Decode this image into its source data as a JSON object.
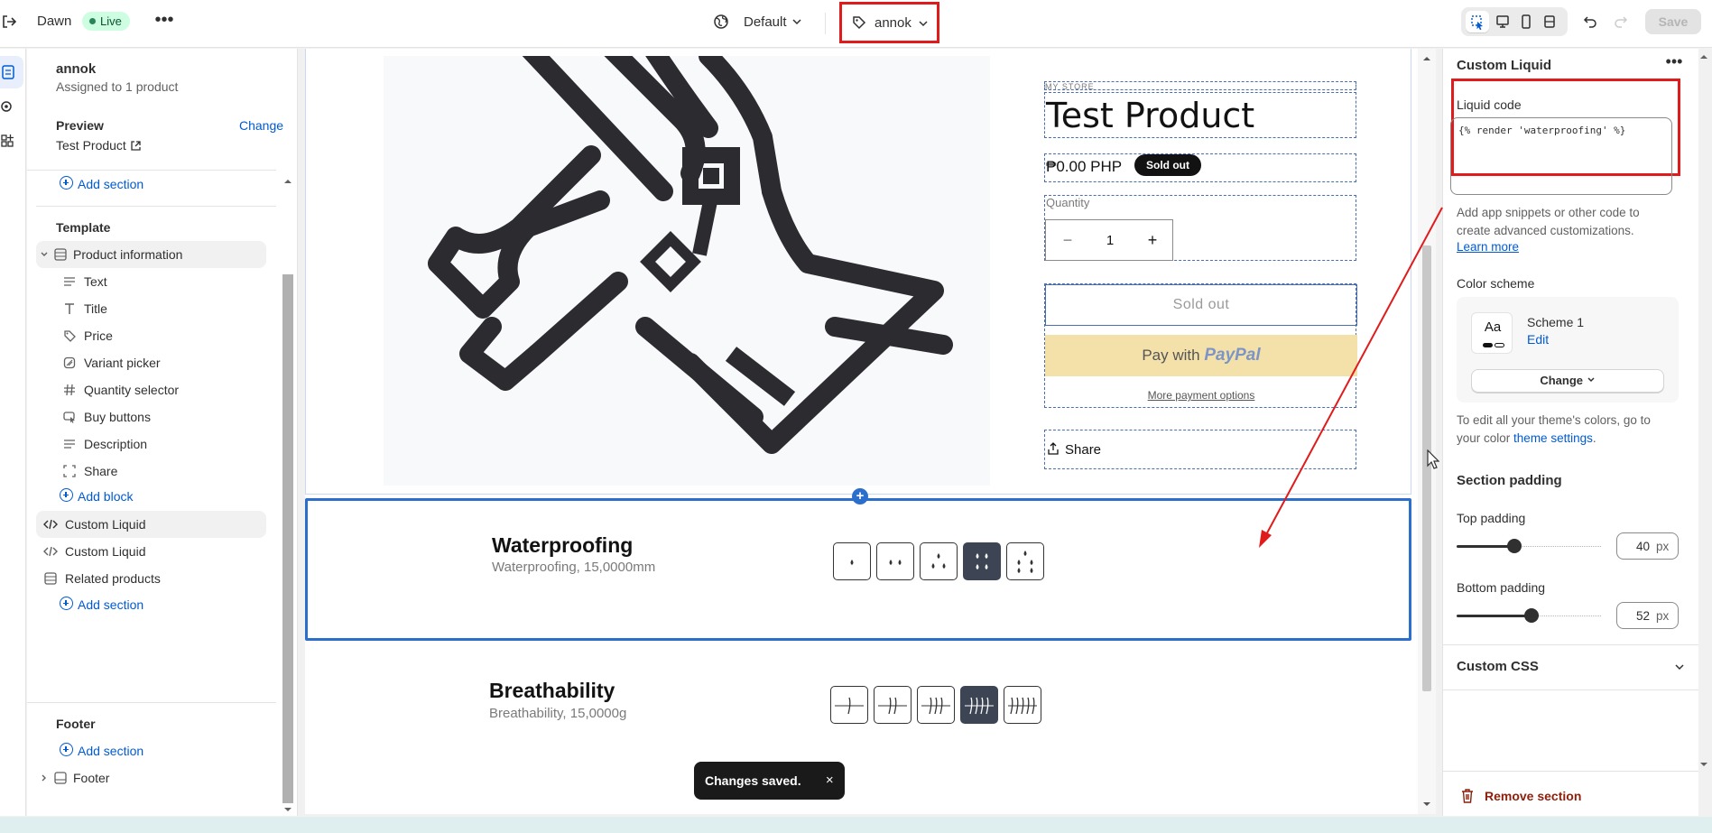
{
  "topbar": {
    "theme_name": "Dawn",
    "live_badge": "Live",
    "more_label": "•••",
    "context_label": "Default",
    "template_label": "annok",
    "save_label": "Save"
  },
  "sidebar": {
    "template_name": "annok",
    "assigned_text": "Assigned to 1 product",
    "preview_label": "Preview",
    "change_label": "Change",
    "preview_product": "Test Product",
    "add_section_label": "Add section",
    "template_group": "Template",
    "product_info_label": "Product information",
    "blocks": [
      "Text",
      "Title",
      "Price",
      "Variant picker",
      "Quantity selector",
      "Buy buttons",
      "Description",
      "Share"
    ],
    "add_block_label": "Add block",
    "sections": [
      "Custom Liquid",
      "Custom Liquid",
      "Related products"
    ],
    "footer_group": "Footer",
    "footer_label": "Footer"
  },
  "preview": {
    "vendor": "MY STORE",
    "title": "Test Product",
    "price": "₱0.00 PHP",
    "sold_badge": "Sold out",
    "quantity_label": "Quantity",
    "quantity_value": "1",
    "qty_minus": "−",
    "qty_plus": "+",
    "sold_out_button": "Sold out",
    "paypal_prefix": "Pay with",
    "paypal_brand": "PayPal",
    "more_payment": "More payment options",
    "share_label": "Share",
    "add_section_plus": "+",
    "features": [
      {
        "title": "Waterproofing",
        "subtitle": "Waterproofing, 15,0000mm",
        "level": 4,
        "max": 5
      },
      {
        "title": "Breathability",
        "subtitle": "Breathability, 15,0000g",
        "level": 4,
        "max": 5
      }
    ],
    "toast_text": "Changes saved.",
    "toast_close": "×"
  },
  "panel": {
    "title": "Custom Liquid",
    "more_label": "•••",
    "liquid_label": "Liquid code",
    "liquid_code": "{% render 'waterproofing' %}",
    "help_text": "Add app snippets or other code to create advanced customizations.",
    "learn_more": "Learn more",
    "color_scheme_label": "Color scheme",
    "scheme_aa": "Aa",
    "scheme_name": "Scheme 1",
    "scheme_edit": "Edit",
    "scheme_change": "Change",
    "theme_colors_text": "To edit all your theme's colors, go to your color",
    "theme_settings_link": "theme settings",
    "theme_settings_tail": ".",
    "padding_head": "Section padding",
    "top_padding_label": "Top padding",
    "top_padding_value": "40",
    "bottom_padding_label": "Bottom padding",
    "bottom_padding_value": "52",
    "unit": "px",
    "slider_max": 100,
    "custom_css_label": "Custom CSS",
    "remove_label": "Remove section"
  },
  "colors": {
    "accent": "#005bd3",
    "highlight": "#e01b1b",
    "selection": "#2c6ecb"
  }
}
